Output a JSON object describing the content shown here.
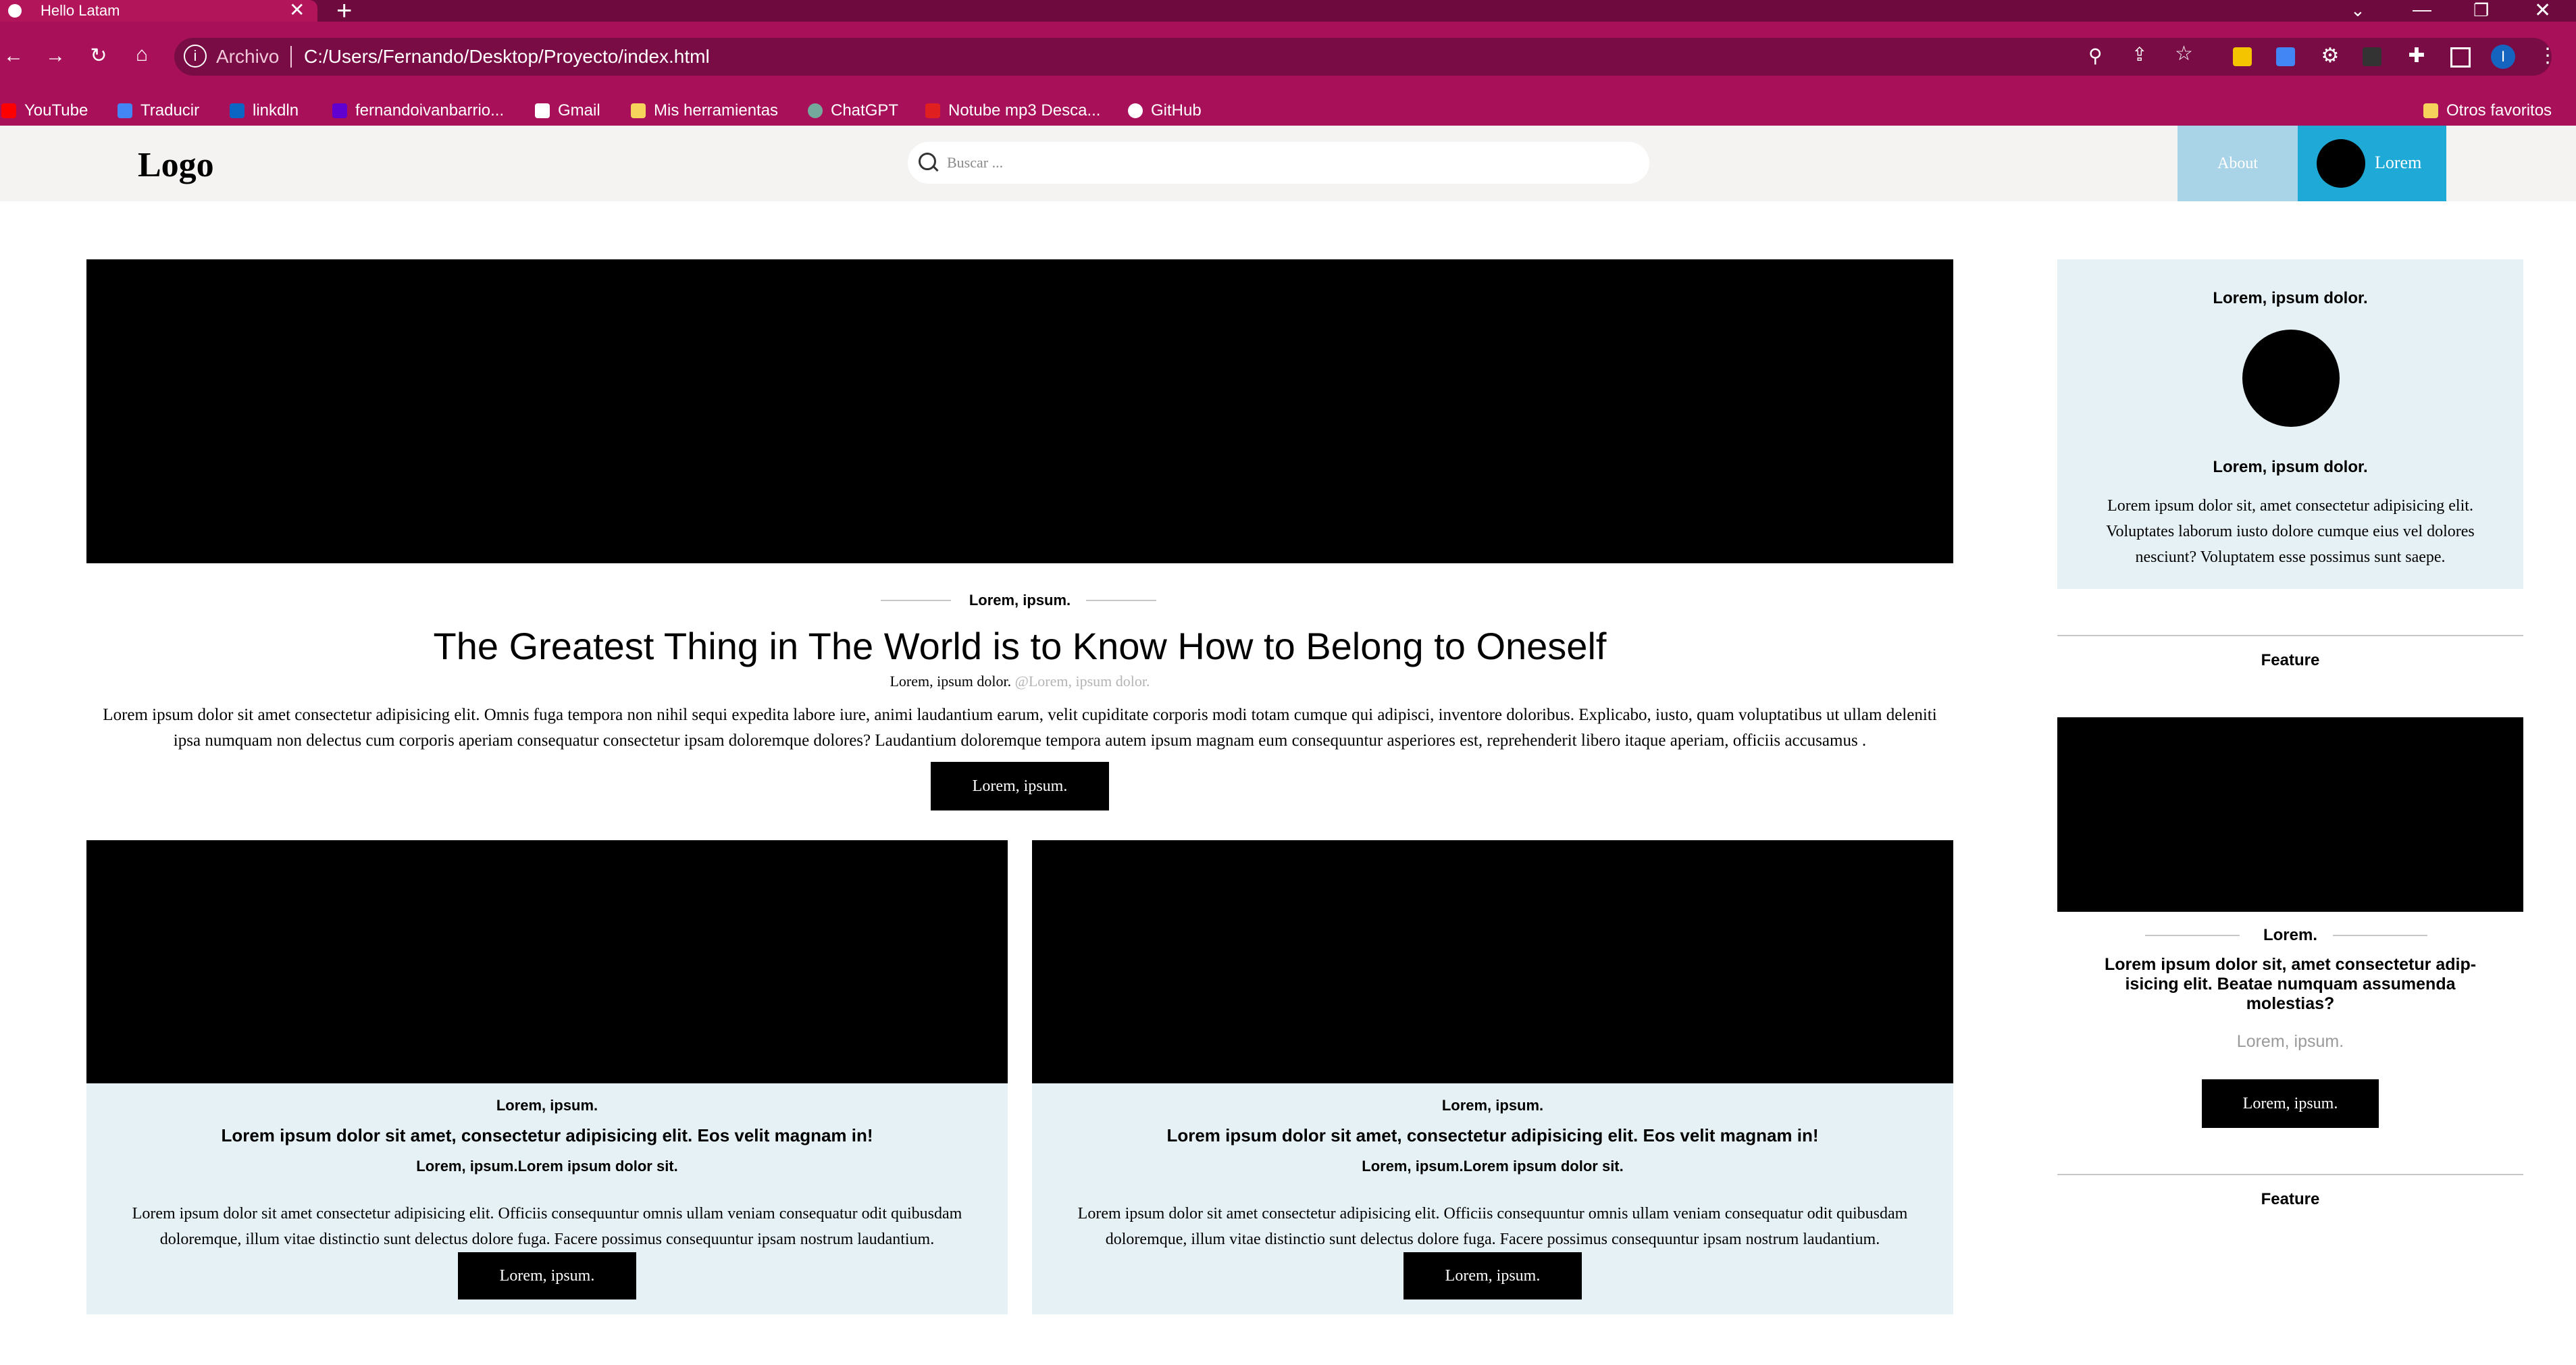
{
  "browser": {
    "tab_title": "Hello Latam",
    "new_tab_symbol": "+",
    "omnibox": {
      "security_label": "Archivo",
      "url": "C:/Users/Fernando/Desktop/Proyecto/index.html"
    },
    "profile_initial": "I",
    "bookmarks": [
      {
        "label": "YouTube",
        "icon": "youtube-icon",
        "color": "#ff0000"
      },
      {
        "label": "Traducir",
        "icon": "translate-icon",
        "color": "#4285f4"
      },
      {
        "label": "linkdln",
        "icon": "linkedin-icon",
        "color": "#0a66c2"
      },
      {
        "label": "fernandoivanbarrio...",
        "icon": "yahoo-mail-icon",
        "color": "#6001d2"
      },
      {
        "label": "Gmail",
        "icon": "gmail-icon",
        "color": "#ffffff"
      },
      {
        "label": "Mis herramientas",
        "icon": "folder-icon",
        "color": "#f6d35b"
      },
      {
        "label": "ChatGPT",
        "icon": "chatgpt-icon",
        "color": "#74aa9c"
      },
      {
        "label": "Notube mp3 Desca...",
        "icon": "notube-icon",
        "color": "#e02020"
      },
      {
        "label": "GitHub",
        "icon": "github-icon",
        "color": "#ffffff"
      }
    ],
    "other_bookmarks": "Otros favoritos"
  },
  "header": {
    "logo": "Logo",
    "search_placeholder": "Buscar ...",
    "nav": {
      "about": "About",
      "lorem": "Lorem"
    }
  },
  "hero": {
    "kicker": "Lorem, ipsum.",
    "title": "The Greatest Thing in The World is to Know How to Belong to Oneself",
    "byline": "Lorem, ipsum dolor.",
    "handle": "@Lorem, ipsum dolor.",
    "body": "Lorem ipsum dolor sit amet consectetur adipisicing elit. Omnis fuga tempora non nihil sequi expedita labore iure, animi laudantium earum, velit cupiditate corporis modi totam cumque qui adipisci, inventore doloribus. Explicabo, iusto, quam voluptatibus ut ullam deleniti ipsa numquam non delectus cum corporis aperiam consequatur consectetur ipsam doloremque dolores? Laudantium doloremque tempora autem ipsum magnam eum consequuntur asperiores est, reprehenderit libero itaque aperiam, officiis accusamus .",
    "button": "Lorem, ipsum."
  },
  "cards": [
    {
      "kicker": "Lorem, ipsum.",
      "title": "Lorem ipsum dolor sit amet, consectetur adipisicing elit. Eos velit magnam in!",
      "subtitle": "Lorem, ipsum.Lorem ipsum dolor sit.",
      "body": "Lorem ipsum dolor sit amet consectetur adipisicing elit. Officiis consequuntur omnis ullam veniam consequatur odit quibusdam doloremque, illum vitae distinctio sunt delectus dolore fuga. Facere possimus consequuntur ipsam nostrum laudantium.",
      "button": "Lorem, ipsum."
    },
    {
      "kicker": "Lorem, ipsum.",
      "title": "Lorem ipsum dolor sit amet, consectetur adipisicing elit. Eos velit magnam in!",
      "subtitle": "Lorem, ipsum.Lorem ipsum dolor sit.",
      "body": "Lorem ipsum dolor sit amet consectetur adipisicing elit. Officiis consequuntur omnis ullam veniam consequatur odit quibusdam doloremque, illum vitae distinctio sunt delectus dolore fuga. Facere possimus consequuntur ipsam nostrum laudantium.",
      "button": "Lorem, ipsum."
    }
  ],
  "sidebar": {
    "profile": {
      "title": "Lorem, ipsum dolor.",
      "name": "Lorem, ipsum dolor.",
      "body": "Lorem ipsum dolor sit, amet consectetur adipisicing elit. Voluptates laborum iusto dolore cumque eius vel dolores nesciunt? Voluptatem esse possimus sunt saepe."
    },
    "feature_label": "Feature",
    "feature": {
      "kicker": "Lorem.",
      "title": "Lorem ipsum dolor sit, amet consectetur adip-isicing elit. Beatae numquam assumenda molestias?",
      "meta": "Lorem, ipsum.",
      "button": "Lorem, ipsum."
    },
    "feature_label_2": "Feature"
  },
  "colors": {
    "tabstrip": "#6e0a3d",
    "toolbar": "#a9105a",
    "header_bg": "#f5f3f2",
    "about_bg": "#a9d3e6",
    "lorem_bg": "#1fa9d6",
    "card_bg": "#e6f1f5"
  }
}
